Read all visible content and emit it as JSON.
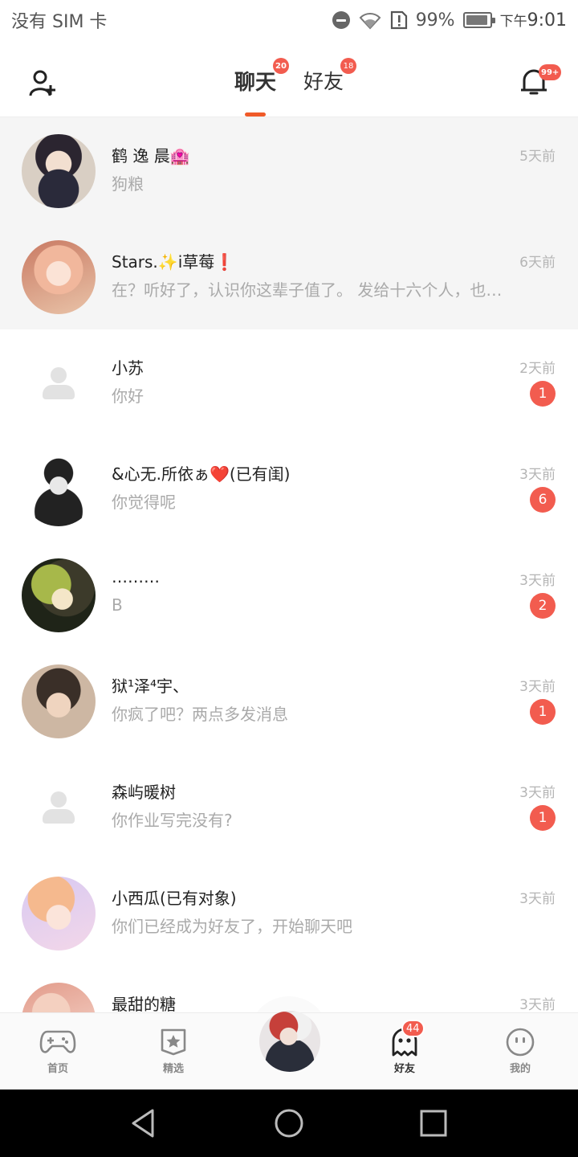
{
  "status_bar": {
    "carrier": "没有 SIM 卡",
    "battery": "99%",
    "time_prefix": "下午",
    "time": "9:01"
  },
  "header": {
    "tabs": [
      {
        "label": "聊天",
        "badge": "20",
        "active": true
      },
      {
        "label": "好友",
        "badge": "18",
        "active": false
      }
    ],
    "notification_badge": "99+",
    "accent_color": "#f05a28"
  },
  "chats": [
    {
      "name": "鹤 逸 晨🏩",
      "message": "狗粮",
      "time": "5天前",
      "unread": "",
      "pinned": true,
      "avatar": "anime-boy-dark-hair"
    },
    {
      "name": "Stars.✨i草莓❗",
      "message": "在？听好了，认识你这辈子值了。 发给十六个人，也包…",
      "time": "6天前",
      "unread": "",
      "pinned": true,
      "avatar": "anime-girl-glasses"
    },
    {
      "name": "小苏",
      "message": "你好",
      "time": "2天前",
      "unread": "1",
      "pinned": false,
      "avatar": "default-user"
    },
    {
      "name": "&心无.所依ぁ❤️(已有闺)",
      "message": "你觉得呢",
      "time": "3天前",
      "unread": "6",
      "pinned": false,
      "avatar": "anime-girl-white-hair"
    },
    {
      "name": "………",
      "message": "B",
      "time": "3天前",
      "unread": "2",
      "pinned": false,
      "avatar": "anime-girl-flowers"
    },
    {
      "name": "狱¹泽⁴宇、",
      "message": "你疯了吧？两点多发消息",
      "time": "3天前",
      "unread": "1",
      "pinned": false,
      "avatar": "anime-boy-brown-hair"
    },
    {
      "name": "森屿暖树",
      "message": "你作业写完没有?",
      "time": "3天前",
      "unread": "1",
      "pinned": false,
      "avatar": "default-user"
    },
    {
      "name": "小西瓜(已有对象)",
      "message": "你们已经成为好友了，开始聊天吧",
      "time": "3天前",
      "unread": "",
      "pinned": false,
      "avatar": "anime-boy-pastel"
    },
    {
      "name": "最甜的糖",
      "message": "",
      "time": "3天前",
      "unread": "",
      "pinned": false,
      "avatar": "anime-girl-pink"
    }
  ],
  "bottom_nav": {
    "items": [
      {
        "label": "首页",
        "icon": "gamepad-icon"
      },
      {
        "label": "精选",
        "icon": "star-icon"
      },
      {
        "label": "",
        "icon": "center-avatar"
      },
      {
        "label": "好友",
        "icon": "ghost-icon",
        "badge": "44",
        "active": true
      },
      {
        "label": "我的",
        "icon": "face-icon"
      }
    ]
  }
}
